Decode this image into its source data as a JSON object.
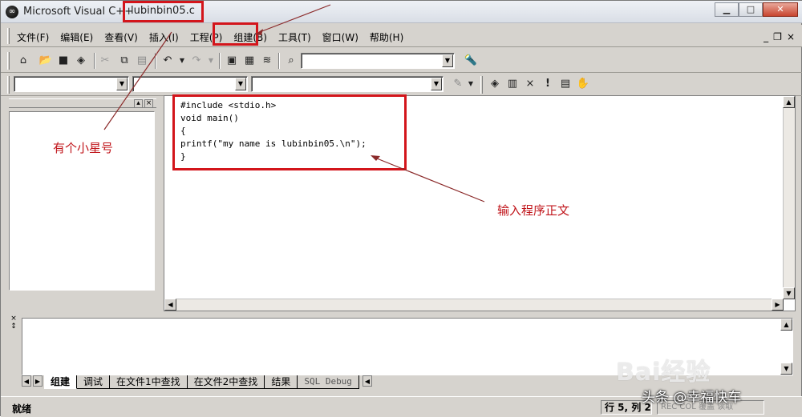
{
  "window": {
    "app_title": "Microsoft Visual C++",
    "doc_title": "lubinbin05.c",
    "buttons": {
      "minimize": "▁",
      "maximize": "□",
      "close": "✕"
    }
  },
  "menu": {
    "items": [
      "文件(F)",
      "编辑(E)",
      "查看(V)",
      "插入(I)",
      "工程(P)",
      "组建(B)",
      "工具(T)",
      "窗口(W)",
      "帮助(H)"
    ],
    "mdi": {
      "minimize": "_",
      "restore": "❐",
      "close": "×"
    }
  },
  "toolbar": {
    "icons": [
      "workspace-icon",
      "open-icon",
      "save-icon",
      "save-all-icon",
      "cut-icon",
      "copy-icon",
      "paste-icon",
      "undo-icon",
      "redo-icon",
      "workspace-toggle-icon",
      "output-icon",
      "window-list-icon",
      "find-in-files-icon",
      "find-icon"
    ],
    "find_combo_value": "",
    "build_icons": [
      "compile-icon",
      "build-icon",
      "stop-build-icon",
      "execute-icon",
      "go-icon",
      "breakpoint-icon"
    ]
  },
  "wizard_bar": {
    "class_combo": "",
    "filter_combo": "",
    "members_combo": ""
  },
  "editor": {
    "lines": [
      "#include <stdio.h>",
      "void main()",
      "{",
      "printf(\"my name is lubinbin05.\\n\");",
      "}"
    ]
  },
  "output": {
    "tabs": [
      "组建",
      "调试",
      "在文件1中查找",
      "在文件2中查找",
      "结果",
      "SQL Debug"
    ],
    "active_tab": 0
  },
  "status": {
    "ready": "就绪",
    "position": "行 5, 列 2",
    "flags": "REC COL 覆盖 读取"
  },
  "annotations": {
    "asterisk_note": "有个小星号",
    "code_note": "输入程序正文",
    "color": "#d3151b"
  },
  "watermarks": {
    "baidu": "Bai经验",
    "credit": "头条 @幸福快车"
  }
}
